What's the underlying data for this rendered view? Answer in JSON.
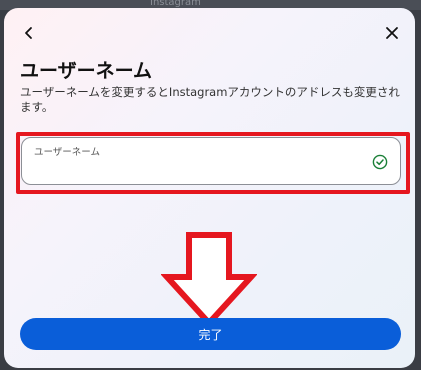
{
  "background_tab_text": "Instagram",
  "dialog": {
    "title": "ユーザーネーム",
    "description": "ユーザーネームを変更するとInstagramアカウントのアドレスも変更されます。",
    "username_field": {
      "label": "ユーザーネーム",
      "value": "",
      "status_icon": "check-circle-icon"
    },
    "done_button": "完了"
  },
  "icons": {
    "back": "chevron-left-icon",
    "close": "close-icon",
    "annotation_arrow": "down-arrow-icon"
  },
  "colors": {
    "accent": "#0a5ed9",
    "highlight": "#e5171f",
    "check": "#1a7f37"
  }
}
